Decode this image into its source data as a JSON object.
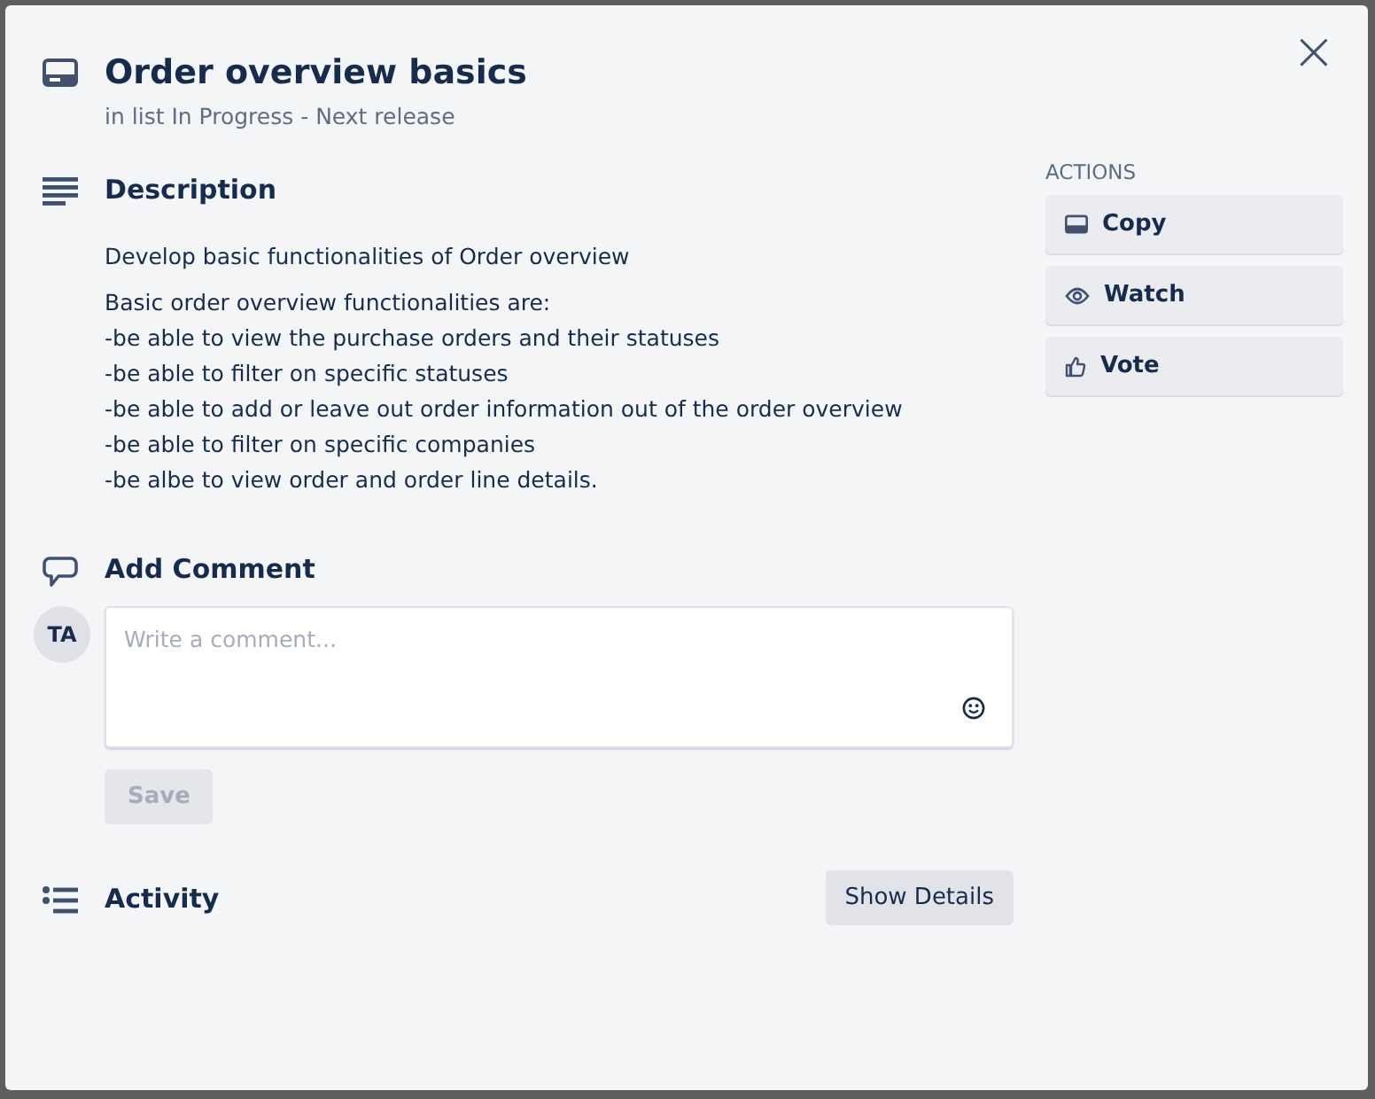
{
  "card": {
    "title": "Order overview basics",
    "subtitle": "in list In Progress - Next release"
  },
  "close_button": {
    "label": "×"
  },
  "description": {
    "heading": "Description",
    "paragraphs": [
      "Develop basic functionalities of Order overview",
      "Basic order overview functionalities are:\n-be able to view the purchase orders and their statuses\n-be able to filter on specific statuses\n-be able to add or leave out order information out of the order overview\n-be able to filter on specific companies\n-be albe to view order and order line details."
    ]
  },
  "comment": {
    "heading": "Add Comment",
    "avatar": "TA",
    "placeholder": "Write a comment...",
    "save_button": {
      "label": "Save",
      "disabled": true
    }
  },
  "activity": {
    "heading": "Activity",
    "button": "Show Details"
  },
  "actions": {
    "heading": "ACTIONS",
    "items": [
      {
        "kind": "copy",
        "label": "Copy"
      },
      {
        "kind": "watch",
        "label": "Watch"
      },
      {
        "kind": "vote",
        "label": "Vote"
      }
    ]
  }
}
